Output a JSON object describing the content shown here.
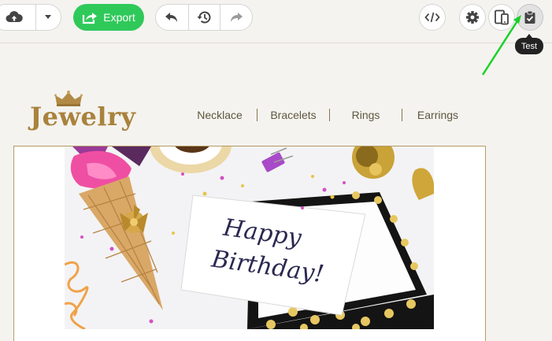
{
  "toolbar": {
    "save_icon": "cloud-upload-icon",
    "dropdown_icon": "caret-down-icon",
    "export_label": "Export",
    "export_icon": "share-out-icon",
    "undo_icon": "undo-icon",
    "history_icon": "history-icon",
    "redo_icon": "redo-icon",
    "code_icon": "code-icon",
    "settings_icon": "gear-icon",
    "preview_icon": "devices-icon",
    "test_icon": "clipboard-check-icon",
    "tooltip": "Test",
    "accent": "#2fc95a"
  },
  "email": {
    "logo_text": "Jewelry",
    "nav": [
      "Necklace",
      "Bracelets",
      "Rings",
      "Earrings"
    ],
    "hero_card_text_line1": "Happy",
    "hero_card_text_line2": "Birthday!",
    "brand_color": "#a9823d"
  }
}
